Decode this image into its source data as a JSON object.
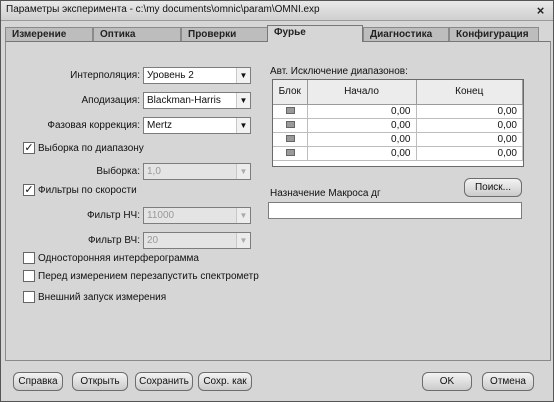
{
  "window": {
    "title": "Параметры эксперимента - c:\\my documents\\omnic\\param\\OMNI.exp",
    "close_glyph": "×"
  },
  "tabs": [
    {
      "label": "Измерение"
    },
    {
      "label": "Оптика"
    },
    {
      "label": "Проверки"
    },
    {
      "label": "Фурье",
      "active": true
    },
    {
      "label": "Диагностика"
    },
    {
      "label": "Конфигурация"
    }
  ],
  "form": {
    "interpolation": {
      "label": "Интерполяция:",
      "value": "Уровень 2"
    },
    "apodization": {
      "label": "Аподизация:",
      "value": "Blackman-Harris"
    },
    "phase_correction": {
      "label": "Фазовая коррекция:",
      "value": "Mertz"
    },
    "range_sampling": {
      "label": "Выборка по диапазону",
      "checked": true
    },
    "sampling": {
      "label": "Выборка:",
      "value": "1,0",
      "disabled": true
    },
    "speed_filters": {
      "label": "Фильтры по скорости",
      "checked": true
    },
    "lowpass": {
      "label": "Фильтр НЧ:",
      "value": "11000",
      "disabled": true
    },
    "highpass": {
      "label": "Фильтр ВЧ:",
      "value": "20",
      "disabled": true
    },
    "one_sided": {
      "label": "Односторонняя интерферограмма",
      "checked": false
    },
    "restart": {
      "label": "Перед измерением перезапустить спектрометр",
      "checked": false
    },
    "external_trigger": {
      "label": "Внешний запуск измерения",
      "checked": false
    }
  },
  "exclusions": {
    "title": "Авт. Исключение диапазонов:",
    "headers": [
      "Блок",
      "Начало",
      "Конец"
    ],
    "rows": [
      {
        "start": "0,00",
        "end": "0,00"
      },
      {
        "start": "0,00",
        "end": "0,00"
      },
      {
        "start": "0,00",
        "end": "0,00"
      },
      {
        "start": "0,00",
        "end": "0,00"
      }
    ]
  },
  "macro": {
    "label": "Назначение Макроса дг",
    "value": "",
    "search_button": "Поиск..."
  },
  "buttons": {
    "help": "Справка",
    "open": "Открыть",
    "save": "Сохранить",
    "save_as": "Сохр. как",
    "ok": "OK",
    "cancel": "Отмена"
  }
}
